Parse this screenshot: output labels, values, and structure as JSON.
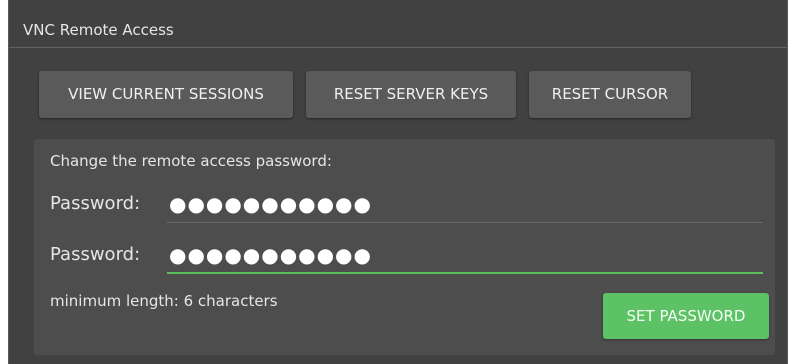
{
  "panel": {
    "title": "VNC Remote Access"
  },
  "actions": {
    "view_sessions_label": "VIEW CURRENT SESSIONS",
    "reset_keys_label": "RESET SERVER KEYS",
    "reset_cursor_label": "RESET CURSOR"
  },
  "password_form": {
    "heading": "Change the remote access password:",
    "password_label_1": "Password:",
    "password_value_1": "●●●●●●●●●●●",
    "password_label_2": "Password:",
    "password_value_2": "●●●●●●●●●●●",
    "hint": "minimum length: 6 characters",
    "set_label": "SET PASSWORD"
  },
  "colors": {
    "panel_bg": "#414141",
    "button_bg": "#5a5a5a",
    "accent_green": "#5cc265",
    "focus_underline": "#5cbd5c"
  }
}
